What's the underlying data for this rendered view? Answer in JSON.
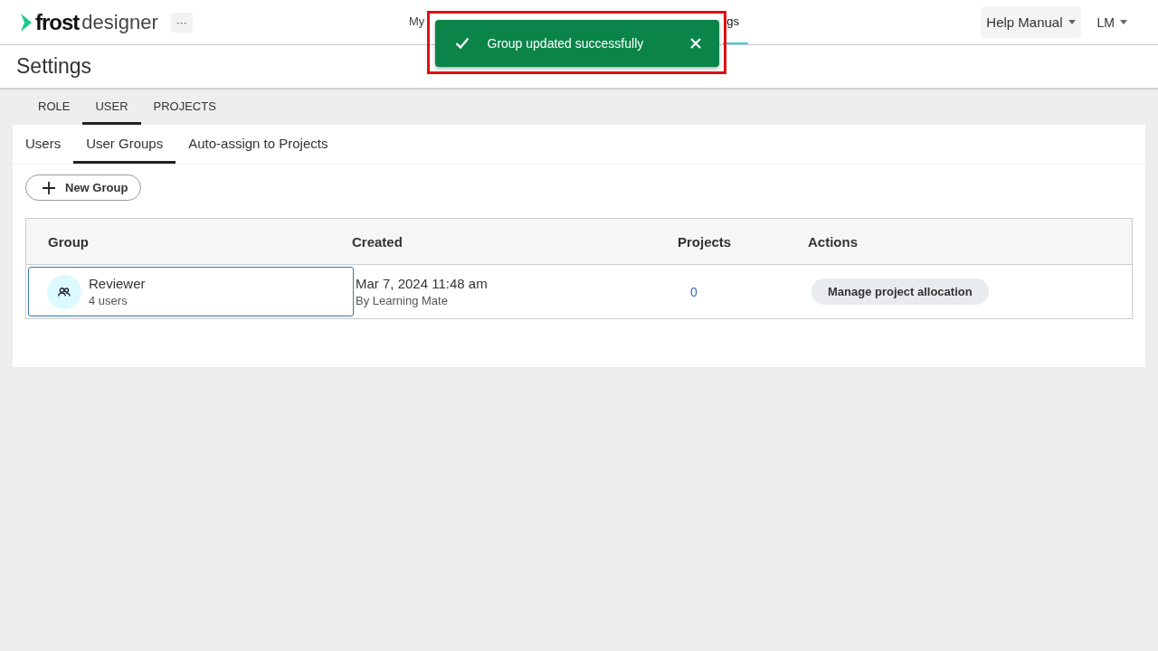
{
  "app": {
    "logo_bold": "frost",
    "logo_light": "designer",
    "more": "···"
  },
  "nav": [
    {
      "label": "My",
      "selected": false
    },
    {
      "label": "gs",
      "selected": true
    }
  ],
  "help_menu": {
    "label": "Help Manual"
  },
  "user_menu": {
    "label": "LM"
  },
  "toast": {
    "message": "Group updated successfully",
    "highlighted": true
  },
  "page_title": "Settings",
  "tabs": [
    {
      "label": "ROLE",
      "selected": false
    },
    {
      "label": "USER",
      "selected": true
    },
    {
      "label": "PROJECTS",
      "selected": false
    }
  ],
  "subtabs": [
    {
      "label": "Users",
      "selected": false
    },
    {
      "label": "User Groups",
      "selected": true
    },
    {
      "label": "Auto-assign to Projects",
      "selected": false
    }
  ],
  "new_group_button": "New Group",
  "table": {
    "columns": [
      "Group",
      "Created",
      "Projects",
      "Actions"
    ],
    "rows": [
      {
        "group": "Reviewer",
        "members": "4 users",
        "created": "Mar 7, 2024 11:48 am",
        "created_by": "By Learning Mate",
        "projects": "0",
        "action": "Manage project allocation",
        "selected": true
      }
    ]
  }
}
